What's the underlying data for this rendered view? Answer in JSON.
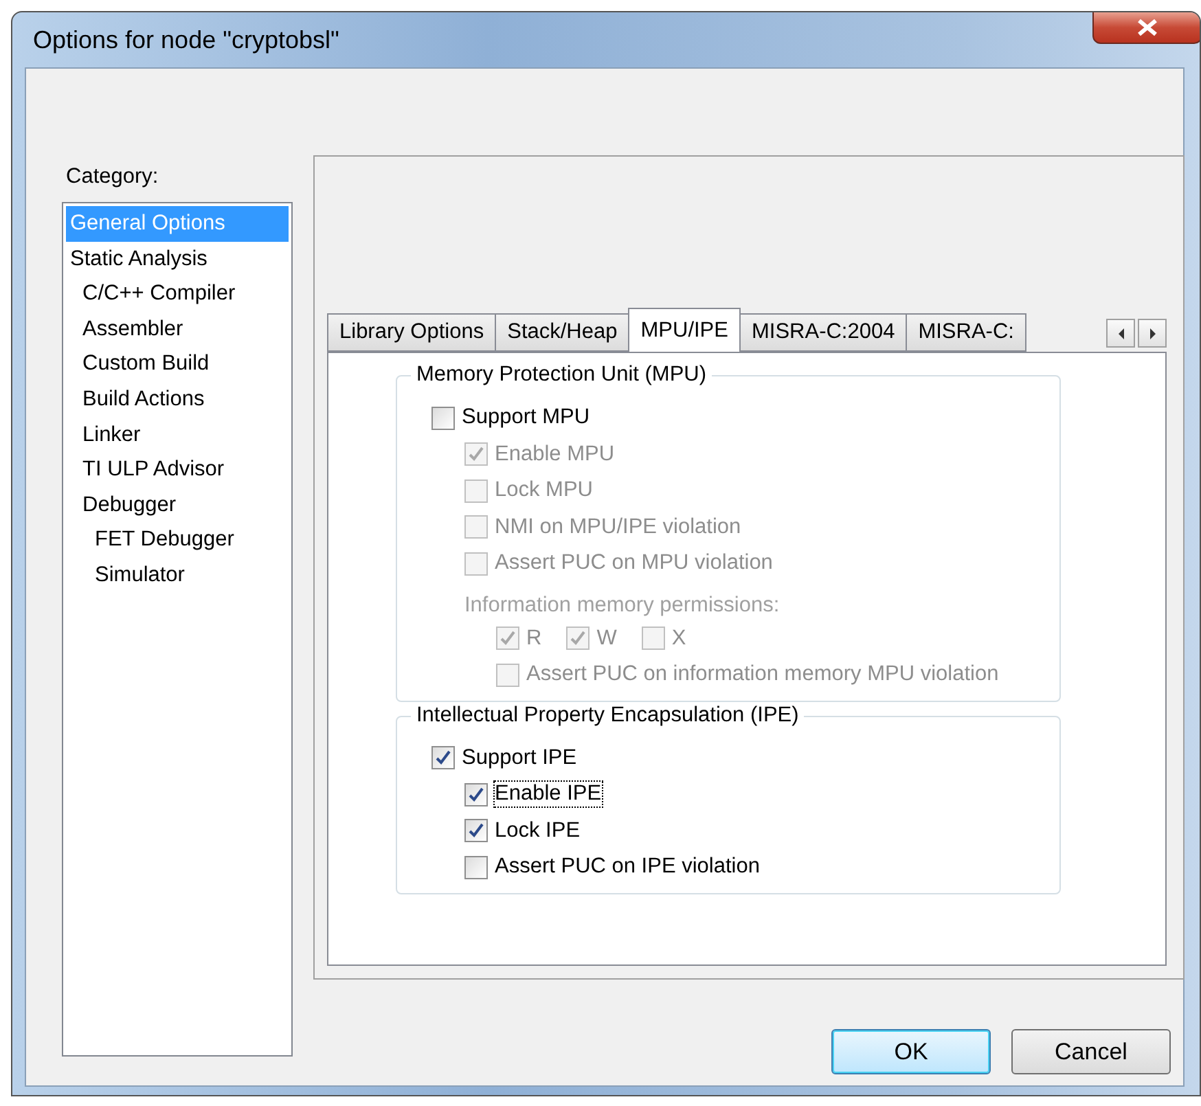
{
  "window": {
    "title": "Options for node \"cryptobsl\""
  },
  "category": {
    "label": "Category:",
    "items": [
      {
        "label": "General Options",
        "selected": true
      },
      {
        "label": "Static Analysis",
        "selected": false,
        "children": [
          {
            "label": "C/C++ Compiler",
            "selected": false
          },
          {
            "label": "Assembler",
            "selected": false
          },
          {
            "label": "Custom Build",
            "selected": false
          },
          {
            "label": "Build Actions",
            "selected": false
          },
          {
            "label": "Linker",
            "selected": false
          },
          {
            "label": "TI ULP Advisor",
            "selected": false
          },
          {
            "label": "Debugger",
            "selected": false,
            "children": [
              {
                "label": "FET Debugger",
                "selected": false
              },
              {
                "label": "Simulator",
                "selected": false
              }
            ]
          }
        ]
      }
    ]
  },
  "tabs": [
    {
      "label": "Library Options",
      "selected": false
    },
    {
      "label": "Stack/Heap",
      "selected": false
    },
    {
      "label": "MPU/IPE",
      "selected": true
    },
    {
      "label": "MISRA-C:2004",
      "selected": false
    },
    {
      "label": "MISRA-C:",
      "selected": false
    }
  ],
  "groups": [
    {
      "title": "Memory Protection Unit (MPU)",
      "options": [
        {
          "kind": "checkbox",
          "label": "Support MPU",
          "checked": false,
          "disabled": false,
          "focused": false,
          "children": [
            {
              "kind": "checkbox",
              "label": "Enable MPU",
              "checked": true,
              "disabled": true,
              "focused": false
            },
            {
              "kind": "checkbox",
              "label": "Lock MPU",
              "checked": false,
              "disabled": true,
              "focused": false
            },
            {
              "kind": "checkbox",
              "label": "NMI on MPU/IPE violation",
              "checked": false,
              "disabled": true,
              "focused": false
            },
            {
              "kind": "checkbox",
              "label": "Assert PUC on MPU violation",
              "checked": false,
              "disabled": true,
              "focused": false
            },
            {
              "kind": "caption",
              "label": "Information memory permissions:",
              "disabled": true,
              "children": [
                {
                  "kind": "row",
                  "items": [
                    {
                      "label": "R",
                      "checked": true,
                      "disabled": true
                    },
                    {
                      "label": "W",
                      "checked": true,
                      "disabled": true
                    },
                    {
                      "label": "X",
                      "checked": false,
                      "disabled": true
                    }
                  ]
                },
                {
                  "kind": "checkbox",
                  "label": "Assert PUC on information memory MPU violation",
                  "checked": false,
                  "disabled": true,
                  "focused": false
                }
              ]
            }
          ]
        }
      ]
    },
    {
      "title": "Intellectual Property Encapsulation (IPE)",
      "options": [
        {
          "kind": "checkbox",
          "label": "Support IPE",
          "checked": true,
          "disabled": false,
          "focused": false,
          "children": [
            {
              "kind": "checkbox",
              "label": "Enable IPE",
              "checked": true,
              "disabled": false,
              "focused": true
            },
            {
              "kind": "checkbox",
              "label": "Lock IPE",
              "checked": true,
              "disabled": false,
              "focused": false
            },
            {
              "kind": "checkbox",
              "label": "Assert PUC on IPE violation",
              "checked": false,
              "disabled": false,
              "focused": false
            }
          ]
        }
      ]
    }
  ],
  "buttons": [
    {
      "label": "OK",
      "default": true
    },
    {
      "label": "Cancel",
      "default": false
    }
  ]
}
